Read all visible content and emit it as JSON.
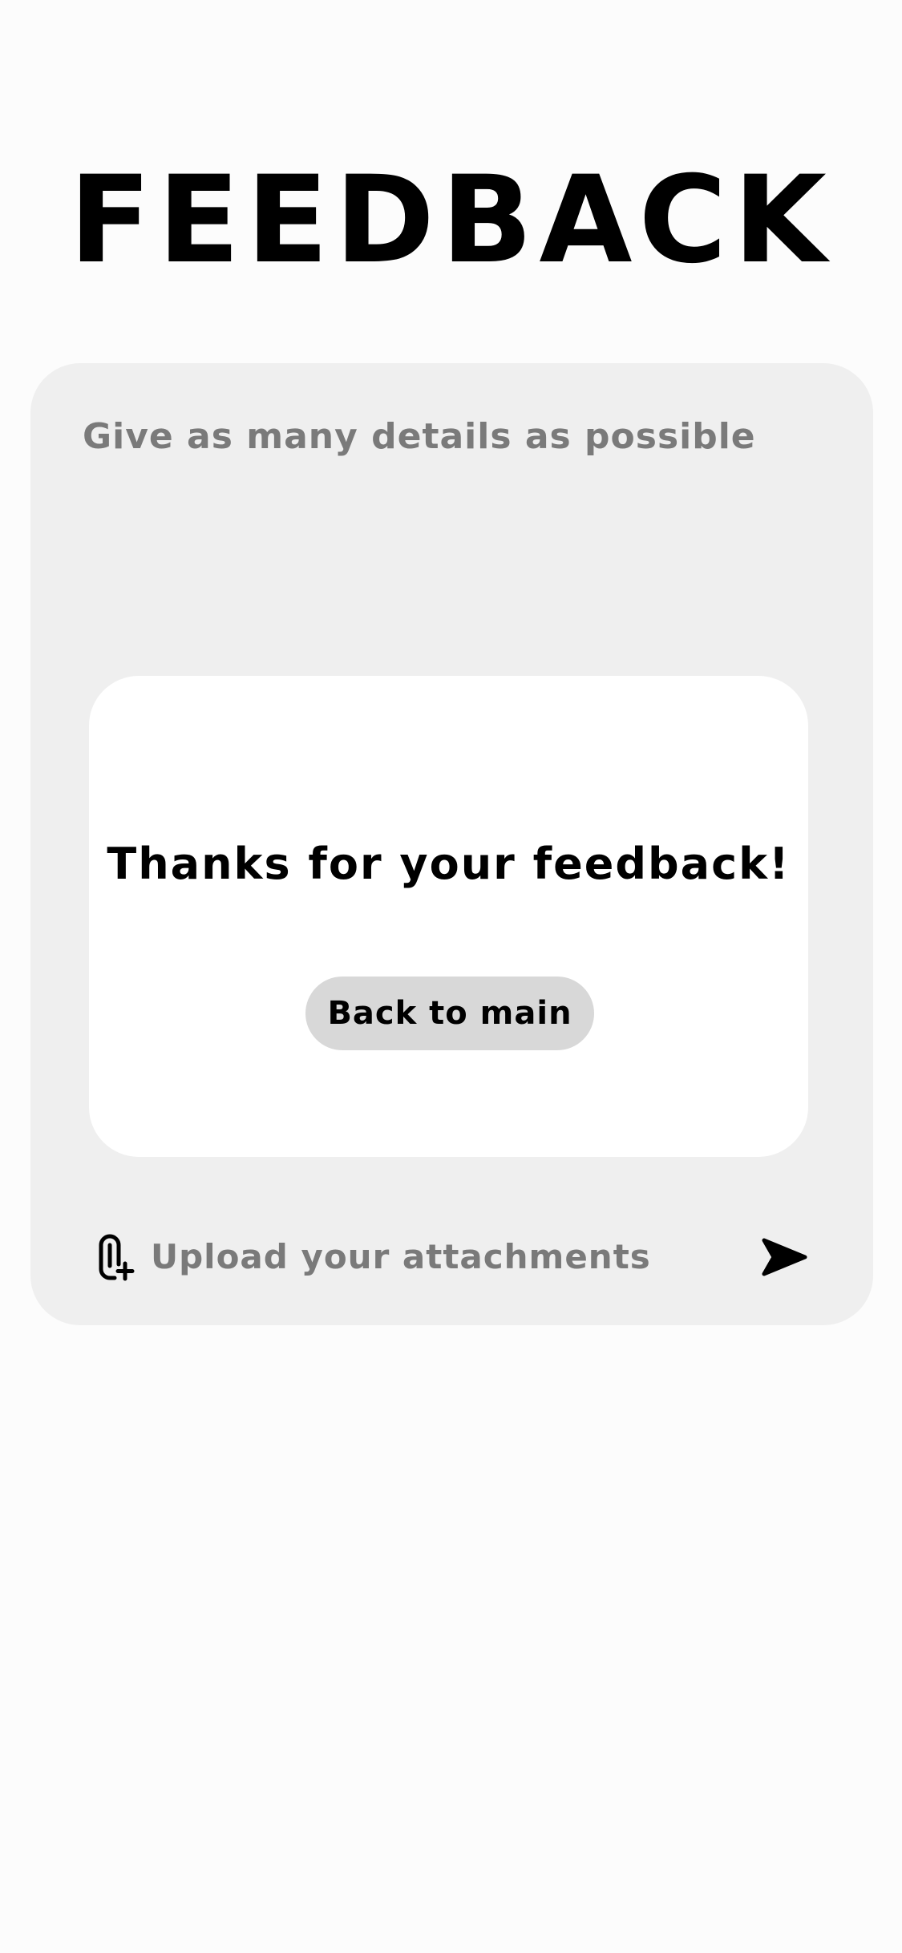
{
  "header": {
    "title": "FEEDBACK"
  },
  "form": {
    "details_placeholder": "Give as many details as possible",
    "upload_label": "Upload your attachments",
    "attach_icon": "paperclip-plus-icon",
    "send_icon": "send-arrow-icon"
  },
  "modal": {
    "message": "Thanks for your feedback!",
    "back_button_label": "Back to main"
  },
  "colors": {
    "background": "#fcfcfc",
    "card": "#efefef",
    "modal": "#ffffff",
    "button": "#d8d8d8",
    "muted_text": "#7a7a7a",
    "text": "#000000"
  }
}
